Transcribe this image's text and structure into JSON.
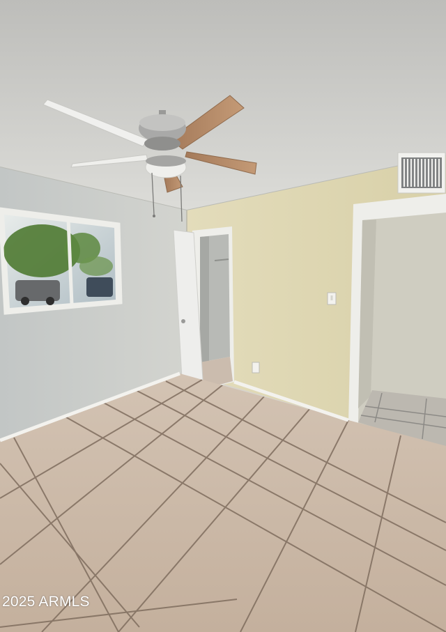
{
  "watermark": {
    "text": "2025 ARMLS"
  },
  "colors": {
    "ceiling": "#cfcfcc",
    "left_wall": "#c9ccca",
    "right_wall": "#ddd6b0",
    "floor_tile": "#c9b7a4",
    "grout": "#7d6c5e",
    "baseboard": "#f2f1ec",
    "door": "#eeeeec",
    "closet_interior": "#b8bab6",
    "fan_blade": "#b78d6c"
  },
  "scene": {
    "objects": [
      "ceiling-fan",
      "window",
      "closet-door",
      "doorway",
      "hvac-vent",
      "light-switch",
      "power-outlet",
      "tile-floor"
    ]
  }
}
